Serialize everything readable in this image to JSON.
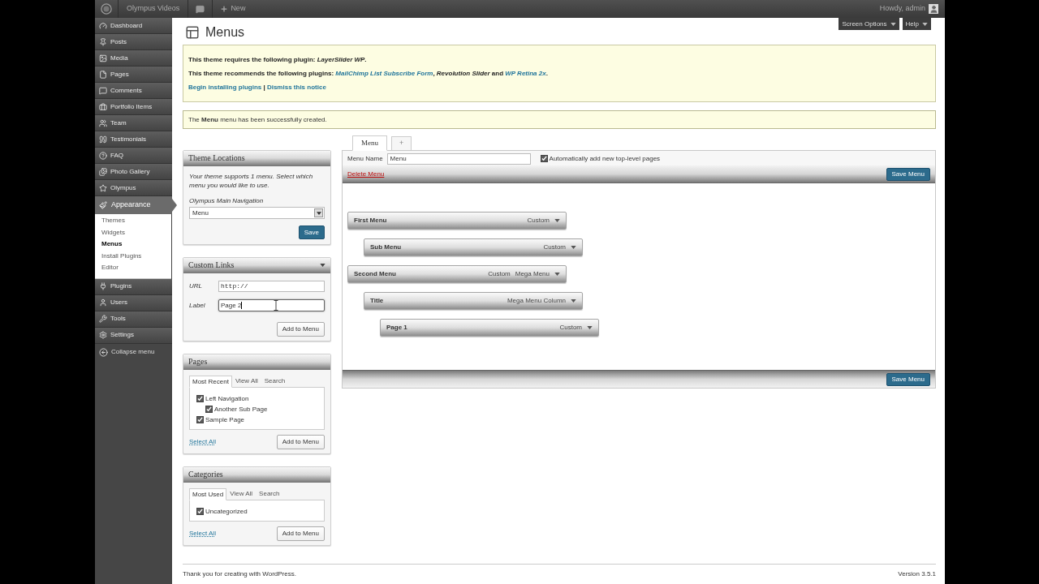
{
  "admin_bar": {
    "site_name": "Olympus Videos",
    "new_label": "New",
    "greeting": "Howdy, admin"
  },
  "sidebar": {
    "items": [
      {
        "label": "Dashboard",
        "selected": false
      },
      {
        "label": "Posts",
        "selected": false
      },
      {
        "label": "Media",
        "selected": false
      },
      {
        "label": "Pages",
        "selected": false
      },
      {
        "label": "Comments",
        "selected": false
      },
      {
        "label": "Portfolio Items",
        "selected": false
      },
      {
        "label": "Team",
        "selected": false
      },
      {
        "label": "Testimonials",
        "selected": false
      },
      {
        "label": "FAQ",
        "selected": false
      },
      {
        "label": "Photo Gallery",
        "selected": false
      },
      {
        "label": "Olympus",
        "selected": false
      },
      {
        "label": "Appearance",
        "selected": true,
        "children": [
          {
            "label": "Themes",
            "selected": false
          },
          {
            "label": "Widgets",
            "selected": false
          },
          {
            "label": "Menus",
            "selected": true
          },
          {
            "label": "Install Plugins",
            "selected": false
          },
          {
            "label": "Editor",
            "selected": false
          }
        ]
      },
      {
        "label": "Plugins",
        "selected": false
      },
      {
        "label": "Users",
        "selected": false
      },
      {
        "label": "Tools",
        "selected": false
      },
      {
        "label": "Settings",
        "selected": false
      }
    ],
    "collapse_label": "Collapse menu"
  },
  "screen_meta_buttons": [
    "Screen Options",
    "Help"
  ],
  "page_title": "Menus",
  "notices": [
    {
      "kind": "plugins",
      "lines": [
        [
          {
            "kind": "text",
            "text": "This theme requires the following plugin: "
          },
          {
            "kind": "plugin",
            "text": "LayerSlider WP"
          },
          {
            "kind": "text",
            "text": "."
          }
        ],
        [
          {
            "kind": "text",
            "text": "This theme recommends the following plugins: "
          },
          {
            "kind": "plugin_link",
            "text": "MailChimp List Subscribe Form"
          },
          {
            "kind": "text",
            "text": ", "
          },
          {
            "kind": "plugin",
            "text": "Revolution Slider"
          },
          {
            "kind": "text",
            "text": " and "
          },
          {
            "kind": "plugin_link",
            "text": "WP Retina 2x"
          },
          {
            "kind": "text",
            "text": "."
          }
        ],
        [
          {
            "kind": "link",
            "text": "Begin installing plugins"
          },
          {
            "kind": "text",
            "text": " | "
          },
          {
            "kind": "link",
            "text": "Dismiss this notice"
          }
        ]
      ]
    },
    {
      "kind": "message",
      "lines": [
        [
          {
            "kind": "text",
            "text": "The **Menu** menu has been successfully created."
          }
        ]
      ]
    }
  ],
  "left_panels": [
    {
      "kind": "theme_locations",
      "title": "Theme Locations",
      "hovered": false,
      "description": "Your theme supports 1 menu. Select which menu you would like to use.",
      "location_label": "Olympus Main Navigation",
      "select_value": "Menu",
      "button": "Save"
    },
    {
      "kind": "custom_links",
      "title": "Custom Links",
      "hovered": true,
      "fields": [
        {
          "kind": "url",
          "label": "URL",
          "value": "http://",
          "focused": false
        },
        {
          "kind": "text",
          "label": "Label",
          "value": "Page 2",
          "focused": true
        }
      ],
      "button": "Add to Menu"
    },
    {
      "kind": "checklist",
      "title": "Pages",
      "hovered": false,
      "tabs": [
        {
          "label": "Most Recent",
          "selected": true
        },
        {
          "label": "View All",
          "selected": false
        },
        {
          "label": "Search",
          "selected": false
        }
      ],
      "items": [
        {
          "label": "Left Navigation",
          "checked": true,
          "children": [
            {
              "label": "Another Sub Page",
              "checked": true
            }
          ]
        },
        {
          "label": "Sample Page",
          "checked": true
        }
      ],
      "select_all": "Select All",
      "button": "Add to Menu"
    },
    {
      "kind": "checklist",
      "title": "Categories",
      "hovered": false,
      "tabs": [
        {
          "label": "Most Used",
          "selected": true
        },
        {
          "label": "View All",
          "selected": false
        },
        {
          "label": "Search",
          "selected": false
        }
      ],
      "items": [
        {
          "label": "Uncategorized",
          "checked": true
        }
      ],
      "select_all": "Select All",
      "button": "Add to Menu"
    }
  ],
  "menu_editor": {
    "tabs": [
      {
        "label": "Menu",
        "selected": true
      },
      {
        "label": "+",
        "selected": false
      }
    ],
    "name_label": "Menu Name",
    "name_value": "Menu",
    "auto_add": {
      "label": "Automatically add new top-level pages",
      "checked": true
    },
    "delete_label": "Delete Menu",
    "save_top": "Save Menu",
    "save_bottom": "Save Menu",
    "items": [
      {
        "title": "First Menu",
        "types": [
          "Custom"
        ],
        "children": [
          {
            "title": "Sub Menu",
            "types": [
              "Custom"
            ]
          }
        ]
      },
      {
        "title": "Second Menu",
        "types": [
          "Custom",
          "Mega Menu"
        ],
        "children": [
          {
            "title": "Title",
            "types": [
              "Mega Menu Column"
            ],
            "children": [
              {
                "title": "Page 1",
                "types": [
                  "Custom"
                ]
              }
            ]
          }
        ]
      }
    ]
  },
  "footer": {
    "thanks": "Thank you for creating with WordPress.",
    "version": "Version 3.5.1"
  }
}
